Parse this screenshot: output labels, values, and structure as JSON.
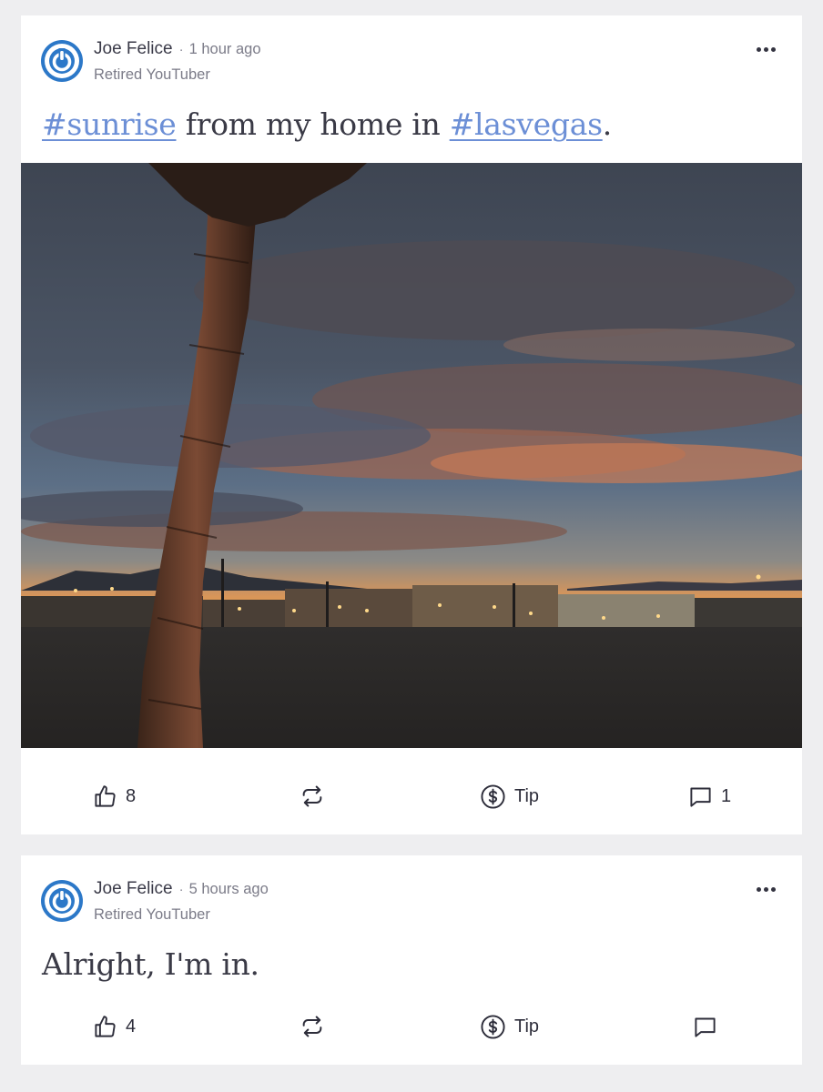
{
  "posts": [
    {
      "author": "Joe Felice",
      "separator": "·",
      "time": "1 hour ago",
      "subtitle": "Retired YouTuber",
      "text": {
        "tag1": "#sunrise",
        "middle": " from my home in ",
        "tag2": "#lasvegas",
        "end": "."
      },
      "image_alt": "Sunrise sky with palm tree over Las Vegas lot",
      "actions": {
        "likes": "8",
        "tip_label": "Tip",
        "comments": "1"
      }
    },
    {
      "author": "Joe Felice",
      "separator": "·",
      "time": "5 hours ago",
      "subtitle": "Retired YouTuber",
      "text": "Alright, I'm in.",
      "actions": {
        "likes": "4",
        "tip_label": "Tip",
        "comments": ""
      }
    }
  ],
  "colors": {
    "avatar": "#2c78c8",
    "hashtag": "#6c8fd6",
    "background": "#eeeef0"
  },
  "icons": [
    "power-avatar-icon",
    "more-options-icon",
    "thumbs-up-icon",
    "repost-icon",
    "dollar-circle-icon",
    "comment-icon"
  ]
}
